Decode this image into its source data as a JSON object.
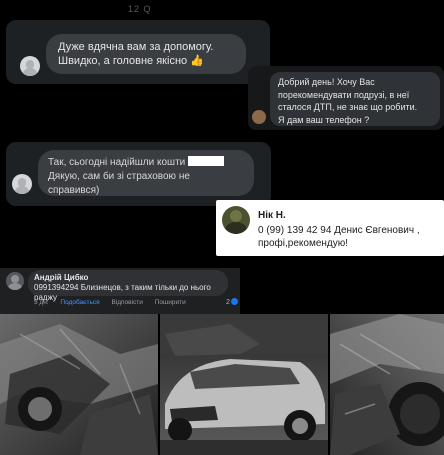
{
  "top_timestamp": "12 Q",
  "messages": [
    {
      "line1": "Дуже вдячна вам за допомогу.",
      "line2": "Швидко, а головне якісно 👍"
    },
    {
      "line1": "Добрий день! Хочу Вас",
      "line2": "порекомендувати подрузі, в неї",
      "line3": "сталося ДТП, не знає що робити.",
      "line4": "Я дам ваш телефон ?"
    },
    {
      "line1": "Так, сьогодні надійшли кошти",
      "line2": "Дякую, сам би зі страховою не справився)"
    }
  ],
  "review": {
    "name": "Нік Н.",
    "text": "0 (99) 139 42 94 Денис Євгенович , профі,рекомендую!"
  },
  "fb_comment": {
    "author": "Андрій Цибко",
    "text": "0991394294 Близнецов, з таким тільки до нього раджу",
    "time": "3 дн.",
    "like": "Подобається",
    "reply": "Відповісти",
    "share": "Поширити",
    "reactions": "2"
  },
  "colors": {
    "background": "#000000",
    "card_dark": "#1e2124",
    "bubble_dark": "#3a3d41",
    "review_card": "#ffffff",
    "fb_like_blue": "#1877f2"
  }
}
